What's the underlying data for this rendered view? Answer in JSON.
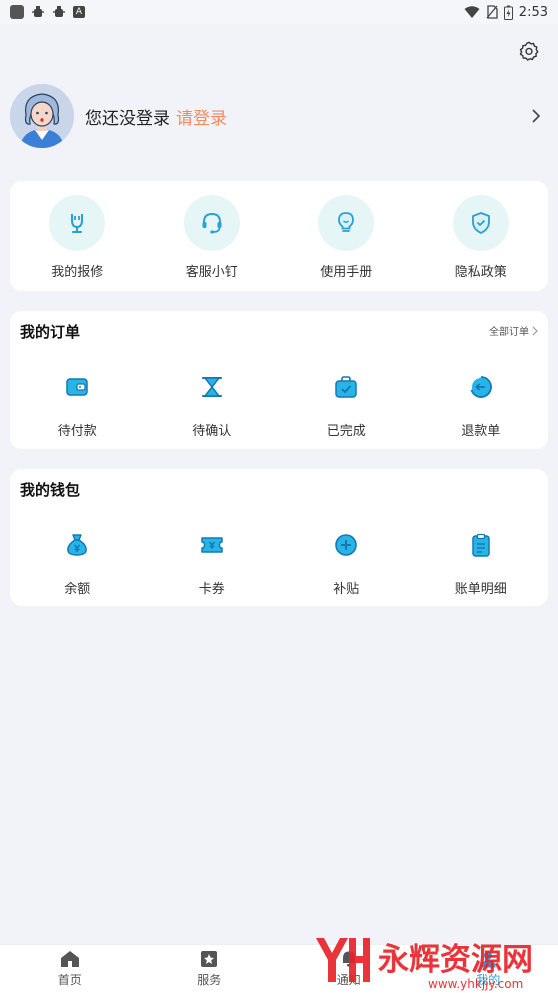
{
  "status_bar": {
    "time": "2:53"
  },
  "profile": {
    "not_logged_text": "您还没登录",
    "login_link": "请登录"
  },
  "quick_actions": [
    {
      "label": "我的报修",
      "icon": "wrench-icon"
    },
    {
      "label": "客服小钉",
      "icon": "headset-icon"
    },
    {
      "label": "使用手册",
      "icon": "lightbulb-icon"
    },
    {
      "label": "隐私政策",
      "icon": "shield-check-icon"
    }
  ],
  "orders": {
    "title": "我的订单",
    "more_label": "全部订单",
    "items": [
      {
        "label": "待付款",
        "icon": "wallet-icon"
      },
      {
        "label": "待确认",
        "icon": "hourglass-icon"
      },
      {
        "label": "已完成",
        "icon": "bag-check-icon"
      },
      {
        "label": "退款单",
        "icon": "refund-icon"
      }
    ]
  },
  "wallet": {
    "title": "我的钱包",
    "items": [
      {
        "label": "余额",
        "icon": "money-bag-icon"
      },
      {
        "label": "卡券",
        "icon": "ticket-icon"
      },
      {
        "label": "补贴",
        "icon": "subsidy-icon"
      },
      {
        "label": "账单明细",
        "icon": "clipboard-icon"
      }
    ]
  },
  "bottom_nav": [
    {
      "label": "首页",
      "icon": "home-icon"
    },
    {
      "label": "服务",
      "icon": "service-icon"
    },
    {
      "label": "通知",
      "icon": "bell-icon"
    },
    {
      "label": "我的",
      "icon": "user-icon",
      "active": true
    }
  ],
  "watermark": {
    "title": "永辉资源网",
    "url": "www.yhkjjy.com"
  },
  "colors": {
    "accent": "#2a9fd6",
    "login_link": "#f08c5d",
    "icon_bg": "#e6f6f7",
    "background": "#f2f3f8"
  }
}
